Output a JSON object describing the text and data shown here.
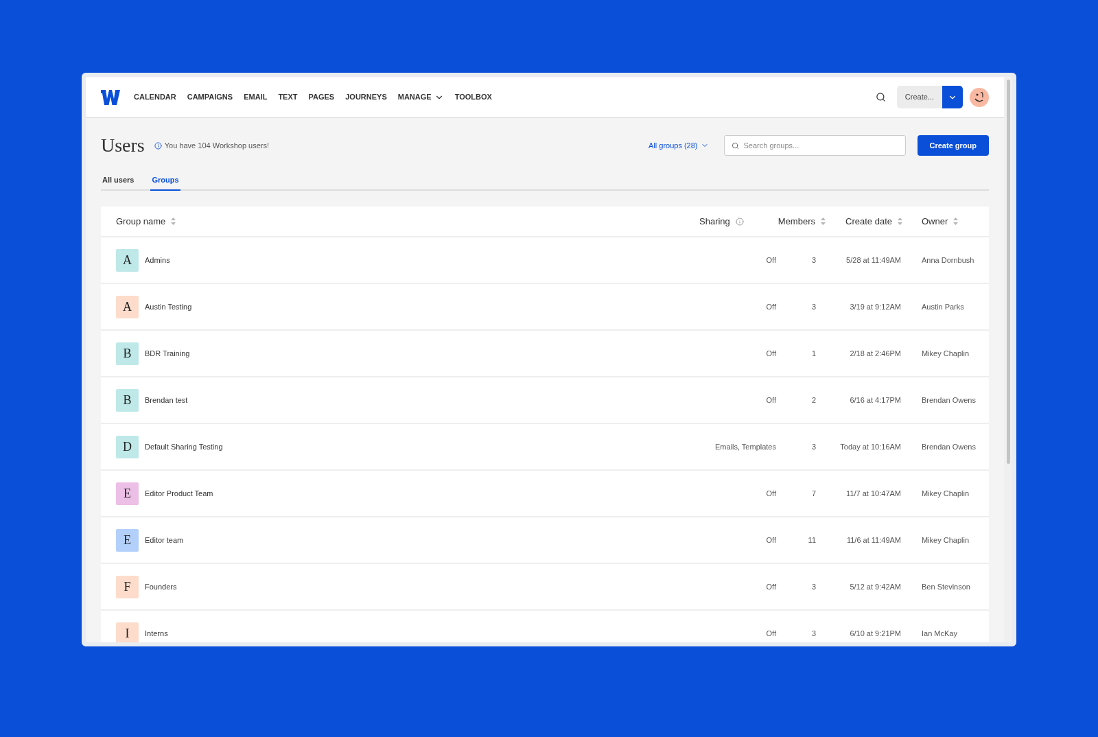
{
  "nav": {
    "items": [
      {
        "label": "CALENDAR",
        "dropdown": false
      },
      {
        "label": "CAMPAIGNS",
        "dropdown": false
      },
      {
        "label": "EMAIL",
        "dropdown": false
      },
      {
        "label": "TEXT",
        "dropdown": false
      },
      {
        "label": "PAGES",
        "dropdown": false
      },
      {
        "label": "JOURNEYS",
        "dropdown": false
      },
      {
        "label": "MANAGE",
        "dropdown": true
      },
      {
        "label": "TOOLBOX",
        "dropdown": false
      }
    ],
    "create_button": "Create..."
  },
  "page": {
    "title": "Users",
    "notice": "You have 104 Workshop users!",
    "filter": "All groups (28)",
    "search": {
      "placeholder": "Search groups..."
    },
    "primary_button": "Create group"
  },
  "tabs": [
    {
      "label": "All users",
      "selected": false
    },
    {
      "label": "Groups",
      "selected": true
    }
  ],
  "table": {
    "columns": [
      {
        "label": "Group name",
        "sortable": true,
        "info": false
      },
      {
        "label": "Sharing",
        "sortable": false,
        "info": true
      },
      {
        "label": "Members",
        "sortable": true,
        "info": false
      },
      {
        "label": "Create date",
        "sortable": true,
        "info": false
      },
      {
        "label": "Owner",
        "sortable": true,
        "info": false
      }
    ],
    "rows": [
      {
        "initial": "A",
        "color": "#bfe8e8",
        "name": "Admins",
        "sharing": "Off",
        "members": "3",
        "date": "5/28 at 11:49AM",
        "owner": "Anna Dornbush"
      },
      {
        "initial": "A",
        "color": "#fddccb",
        "name": "Austin Testing",
        "sharing": "Off",
        "members": "3",
        "date": "3/19 at 9:12AM",
        "owner": "Austin Parks"
      },
      {
        "initial": "B",
        "color": "#bfe8e8",
        "name": "BDR Training",
        "sharing": "Off",
        "members": "1",
        "date": "2/18 at 2:46PM",
        "owner": "Mikey Chaplin"
      },
      {
        "initial": "B",
        "color": "#bfe8e8",
        "name": "Brendan test",
        "sharing": "Off",
        "members": "2",
        "date": "6/16 at 4:17PM",
        "owner": "Brendan Owens"
      },
      {
        "initial": "D",
        "color": "#bfe8e8",
        "name": "Default Sharing Testing",
        "sharing": "Emails, Templates",
        "members": "3",
        "date": "Today at 10:16AM",
        "owner": "Brendan Owens"
      },
      {
        "initial": "E",
        "color": "#ecbfe6",
        "name": "Editor Product Team",
        "sharing": "Off",
        "members": "7",
        "date": "11/7 at 10:47AM",
        "owner": "Mikey Chaplin"
      },
      {
        "initial": "E",
        "color": "#b3d0fb",
        "name": "Editor team",
        "sharing": "Off",
        "members": "11",
        "date": "11/6 at 11:49AM",
        "owner": "Mikey Chaplin"
      },
      {
        "initial": "F",
        "color": "#fddccb",
        "name": "Founders",
        "sharing": "Off",
        "members": "3",
        "date": "5/12 at 9:42AM",
        "owner": "Ben Stevinson"
      },
      {
        "initial": "I",
        "color": "#fddccb",
        "name": "Interns",
        "sharing": "Off",
        "members": "3",
        "date": "6/10 at 9:21PM",
        "owner": "Ian McKay"
      }
    ]
  }
}
